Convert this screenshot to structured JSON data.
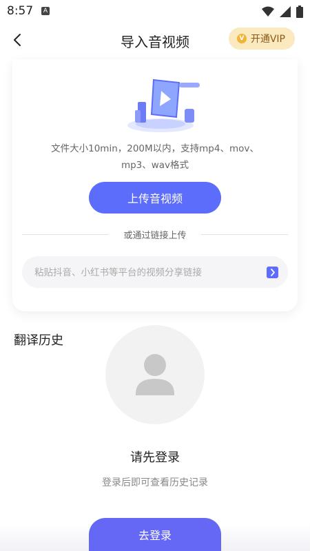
{
  "status_bar": {
    "time": "8:57",
    "notification_badge": "A"
  },
  "header": {
    "title": "导入音视频",
    "vip_label": "开通VIP",
    "vip_badge": "V"
  },
  "upload": {
    "description": "文件大小10min，200M以内，支持mp4、mov、mp3、wav格式",
    "button_label": "上传音视频",
    "divider_text": "或通过链接上传",
    "link_placeholder": "粘贴抖音、小红书等平台的视频分享链接",
    "link_value": ""
  },
  "history": {
    "title": "翻译历史",
    "login_prompt": "请先登录",
    "login_subtext": "登录后即可查看历史记录",
    "login_button": "去登录"
  },
  "colors": {
    "primary": "#5b6dfa",
    "vip_bg": "#fbe9c0",
    "vip_text": "#8a5a12"
  }
}
